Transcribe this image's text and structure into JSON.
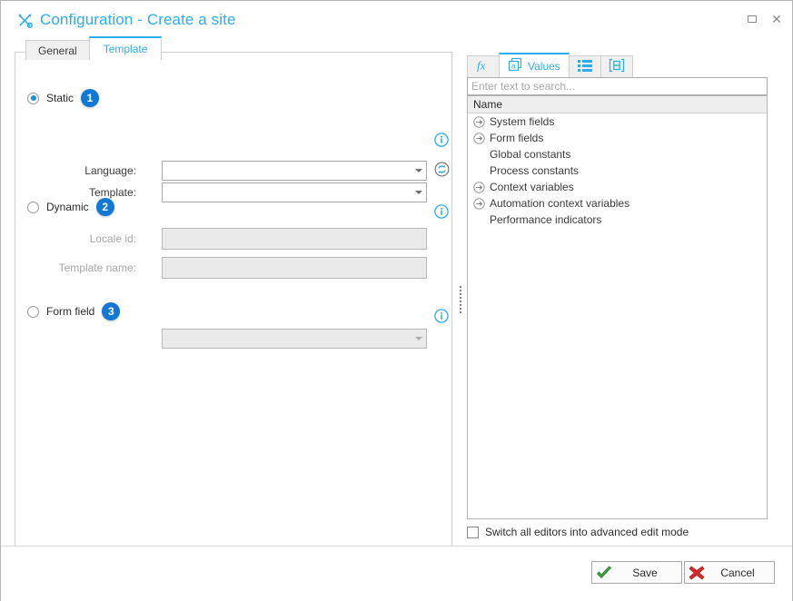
{
  "window": {
    "title": "Configuration - Create a site",
    "title_icon": "tools-icon",
    "accent_color": "#2badef",
    "controls": {
      "maximize": "maximize-icon",
      "close": "close-icon"
    }
  },
  "left_panel": {
    "tabs": [
      {
        "label": "General",
        "active": false
      },
      {
        "label": "Template",
        "active": true
      }
    ],
    "sections": [
      {
        "id": "static",
        "radio_label": "Static",
        "selected": true,
        "badge": "1",
        "info_icon": "info-icon",
        "fields": [
          {
            "label": "Language:",
            "type": "combo",
            "value": "",
            "disabled": false,
            "refresh_icon": "refresh-icon"
          },
          {
            "label": "Template:",
            "type": "combo",
            "value": "",
            "disabled": false
          }
        ]
      },
      {
        "id": "dynamic",
        "radio_label": "Dynamic",
        "selected": false,
        "badge": "2",
        "info_icon": "info-icon",
        "fields": [
          {
            "label": "Locale id:",
            "type": "textbox",
            "value": "",
            "disabled": true
          },
          {
            "label": "Template name:",
            "type": "textbox",
            "value": "",
            "disabled": true
          }
        ]
      },
      {
        "id": "form-field",
        "radio_label": "Form field",
        "selected": false,
        "badge": "3",
        "info_icon": "info-icon",
        "fields": [
          {
            "label": "",
            "type": "combo",
            "value": "",
            "disabled": true
          }
        ]
      }
    ]
  },
  "right_panel": {
    "tabs": [
      {
        "id": "formula",
        "icon": "fx-icon",
        "label": "",
        "active": false
      },
      {
        "id": "values",
        "icon": "values-icon",
        "label": "Values",
        "active": true
      },
      {
        "id": "list",
        "icon": "list-icon",
        "label": "",
        "active": false
      },
      {
        "id": "snippet",
        "icon": "bracket-box-icon",
        "label": "",
        "active": false
      }
    ],
    "search": {
      "placeholder": "Enter text to search...",
      "value": ""
    },
    "tree": {
      "header": "Name",
      "items": [
        {
          "label": "System fields",
          "expandable": true
        },
        {
          "label": "Form fields",
          "expandable": true
        },
        {
          "label": "Global constants",
          "expandable": false
        },
        {
          "label": "Process constants",
          "expandable": false
        },
        {
          "label": "Context variables",
          "expandable": true
        },
        {
          "label": "Automation context variables",
          "expandable": true
        },
        {
          "label": "Performance indicators",
          "expandable": false
        }
      ]
    },
    "advanced_mode": {
      "label": "Switch all editors into advanced edit mode",
      "checked": false
    }
  },
  "footer": {
    "save": {
      "label": "Save",
      "icon": "green-check-icon"
    },
    "cancel": {
      "label": "Cancel",
      "icon": "red-cross-icon"
    }
  }
}
